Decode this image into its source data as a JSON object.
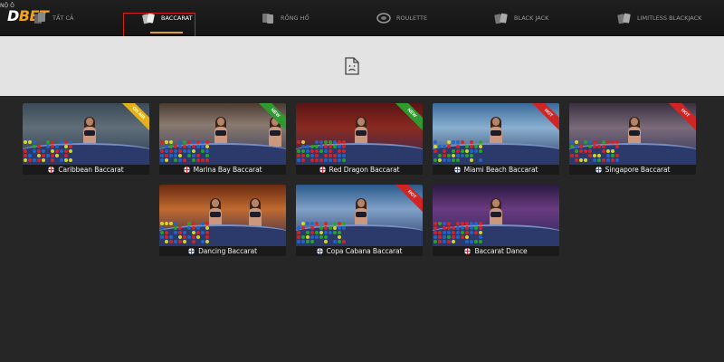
{
  "header": {
    "logo_prefix": "NỘ Ô",
    "logo_d": "D",
    "logo_bet": "BET",
    "tabs": [
      {
        "label": "TẤT CẢ",
        "icon": "cards-icon"
      },
      {
        "label": "BACCARAT",
        "icon": "baccarat-cards-icon",
        "active": true
      },
      {
        "label": "RỒNG HỔ",
        "icon": "dragon-tiger-icon"
      },
      {
        "label": "ROULETTE",
        "icon": "roulette-icon"
      },
      {
        "label": "BLACK JACK",
        "icon": "blackjack-icon"
      },
      {
        "label": "LIMITLESS BLACKJACK",
        "icon": "limitless-blackjack-icon"
      }
    ]
  },
  "banner": {
    "icon": "broken-image-icon"
  },
  "games": [
    {
      "name": "Caribbean Baccarat",
      "flag": "uk-flag-icon",
      "ribbon": "ON AIR",
      "ribbon_color": "#e3b21a"
    },
    {
      "name": "Marina Bay Baccarat",
      "flag": "uk-flag-icon",
      "ribbon": "NEW",
      "ribbon_color": "#2f9a2f"
    },
    {
      "name": "Red Dragon Baccarat",
      "flag": "uk-flag-icon",
      "ribbon": "NEW",
      "ribbon_color": "#2f9a2f"
    },
    {
      "name": "Miami Beach Baccarat",
      "flag": "uk-flag-icon",
      "ribbon": "HOT",
      "ribbon_color": "#d02525"
    },
    {
      "name": "Singapore Baccarat",
      "flag": "uk-flag-icon",
      "ribbon": "HOT",
      "ribbon_color": "#d02525"
    },
    {
      "name": "Dancing Baccarat",
      "flag": "uk-flag-icon",
      "ribbon": "",
      "ribbon_color": ""
    },
    {
      "name": "Copa Cabana Baccarat",
      "flag": "uk-flag-icon",
      "ribbon": "HOT",
      "ribbon_color": "#d02525"
    },
    {
      "name": "Baccarat Dance",
      "flag": "uk-flag-icon",
      "ribbon": "",
      "ribbon_color": ""
    }
  ],
  "colors": {
    "accent": "#f3a31a",
    "highlight": "#d62020"
  }
}
